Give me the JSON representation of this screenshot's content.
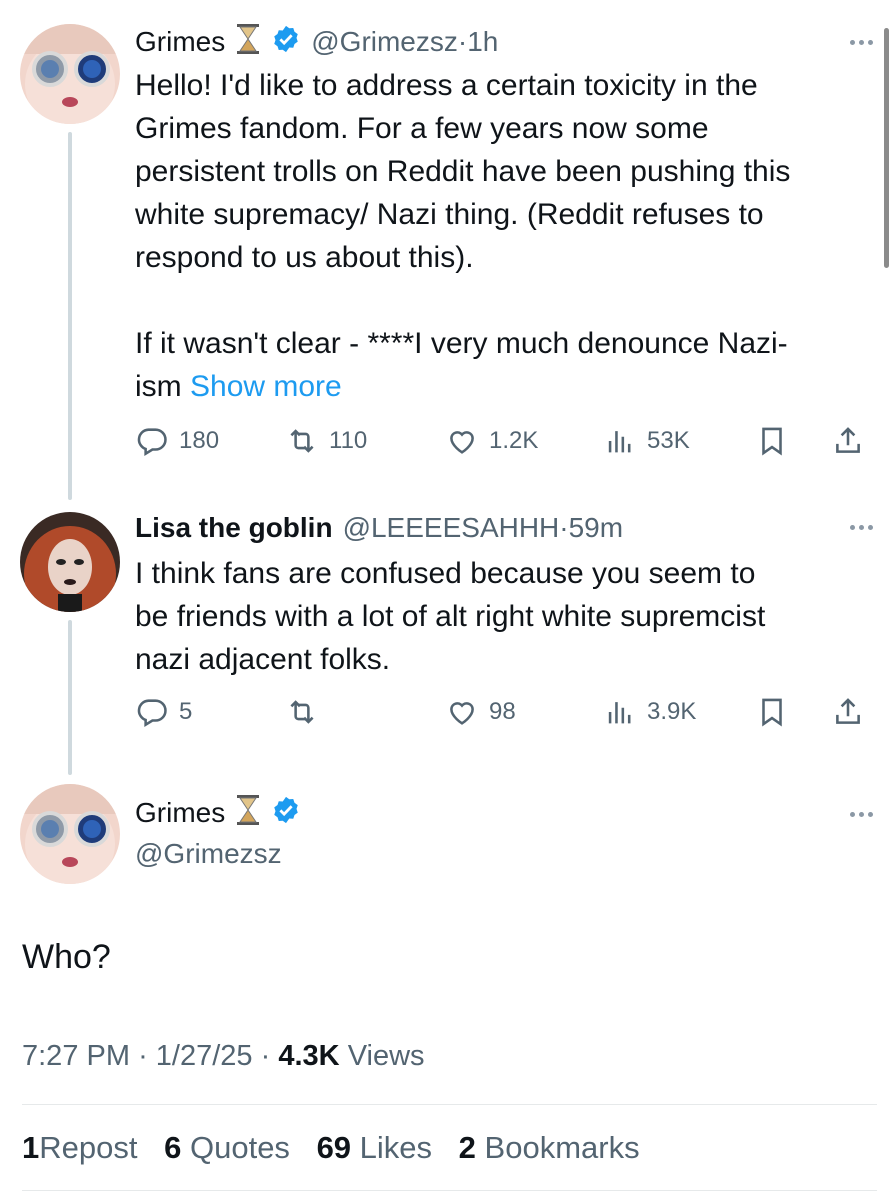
{
  "tweet1": {
    "name": "Grimes",
    "handle": "@Grimezsz",
    "time": "1h",
    "text_lines": [
      "Hello!  I'd like to address a certain toxicity in the",
      "Grimes fandom.  For a few years now some",
      "persistent trolls on Reddit have been pushing this",
      "white supremacy/ Nazi thing.  (Reddit refuses to",
      "respond to us about this).",
      "",
      "If it wasn't clear - ****I very much denounce Nazi-"
    ],
    "last_line": "ism",
    "show_more": "Show more",
    "replies": "180",
    "reposts": "110",
    "likes": "1.2K",
    "views": "53K"
  },
  "tweet2": {
    "name": "Lisa the goblin",
    "handle": "@LEEEESAHHH",
    "time": "59m",
    "text_lines": [
      "I think fans are confused because you seem to",
      "be friends with a lot of alt right white supremcist",
      "nazi adjacent folks."
    ],
    "replies": "5",
    "likes": "98",
    "views": "3.9K"
  },
  "main": {
    "name": "Grimes",
    "handle": "@Grimezsz",
    "text": "Who?",
    "time": "7:27 PM",
    "date": "1/27/25",
    "views_count": "4.3K",
    "views_label": "Views",
    "stats": {
      "reposts_count": "1",
      "reposts_label": "Repost",
      "quotes_count": "6",
      "quotes_label": "Quotes",
      "likes_count": "69",
      "likes_label": "Likes",
      "bookmarks_count": "2",
      "bookmarks_label": "Bookmarks"
    }
  },
  "icons": [
    "hourglass-icon",
    "verified-badge-icon",
    "more-icon",
    "reply-icon",
    "repost-icon",
    "like-icon",
    "views-icon",
    "bookmark-icon",
    "share-icon"
  ],
  "colors": {
    "accent": "#1d9bf0",
    "muted": "#536471",
    "text": "#0f1419",
    "thread_line": "#cfd9de"
  }
}
